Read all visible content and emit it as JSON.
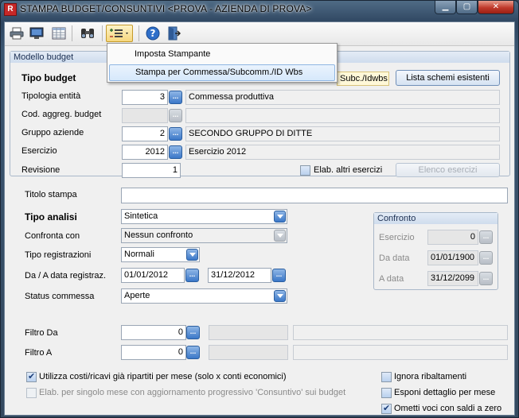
{
  "window": {
    "title": "STAMPA BUDGET/CONSUNTIVI <PROVA - AZIENDA DI PROVA>",
    "app_icon_letter": "R",
    "min_glyph": "▁",
    "max_glyph": "▢",
    "close_glyph": "✕"
  },
  "toolbar": {
    "dropdown_menu": [
      {
        "label": "Imposta Stampante"
      },
      {
        "label": "Stampa per Commessa/Subcomm./ID Wbs"
      }
    ]
  },
  "modello_budget": {
    "title": "Modello budget",
    "tipo_budget_label": "Tipo budget",
    "tipo_budget_value": "Subc./Idwbs",
    "lista_schemi_button": "Lista schemi esistenti",
    "tipologia_entita_label": "Tipologia entità",
    "tipologia_entita_value": "3",
    "tipologia_entita_desc": "Commessa produttiva",
    "cod_aggreg_label": "Cod. aggreg. budget",
    "cod_aggreg_value": "",
    "gruppo_aziende_label": "Gruppo aziende",
    "gruppo_aziende_value": "2",
    "gruppo_aziende_desc": "SECONDO GRUPPO DI DITTE",
    "esercizio_label": "Esercizio",
    "esercizio_value": "2012",
    "esercizio_desc": "Esercizio 2012",
    "revisione_label": "Revisione",
    "revisione_value": "1",
    "elab_altri_label": "Elab. altri esercizi",
    "elenco_esercizi_button": "Elenco esercizi"
  },
  "form": {
    "titolo_stampa_label": "Titolo stampa",
    "titolo_stampa_value": "",
    "tipo_analisi_label": "Tipo analisi",
    "tipo_analisi_value": "Sintetica",
    "confronta_con_label": "Confronta con",
    "confronta_con_value": "Nessun confronto",
    "tipo_registrazioni_label": "Tipo registrazioni",
    "tipo_registrazioni_value": "Normali",
    "data_registraz_label": "Da / A data registraz.",
    "data_da": "01/01/2012",
    "data_a": "31/12/2012",
    "status_commessa_label": "Status commessa",
    "status_commessa_value": "Aperte",
    "filtro_da_label": "Filtro Da",
    "filtro_da_value": "0",
    "filtro_a_label": "Filtro A",
    "filtro_a_value": "0"
  },
  "confronto": {
    "title": "Confronto",
    "esercizio_label": "Esercizio",
    "esercizio_value": "0",
    "da_data_label": "Da data",
    "da_data_value": "01/01/1900",
    "a_data_label": "A data",
    "a_data_value": "31/12/2099"
  },
  "options": {
    "utilizza_costi_label": "Utilizza costi/ricavi già ripartiti per mese  (solo x conti economici)",
    "elab_singolo_mese_label": "Elab. per singolo mese con aggiornamento progressivo 'Consuntivo' sui budget",
    "ignora_ribaltamenti_label": "Ignora ribaltamenti",
    "esponi_dettaglio_label": "Esponi dettaglio per mese",
    "ometti_voci_label": "Ometti voci con saldi a zero"
  }
}
